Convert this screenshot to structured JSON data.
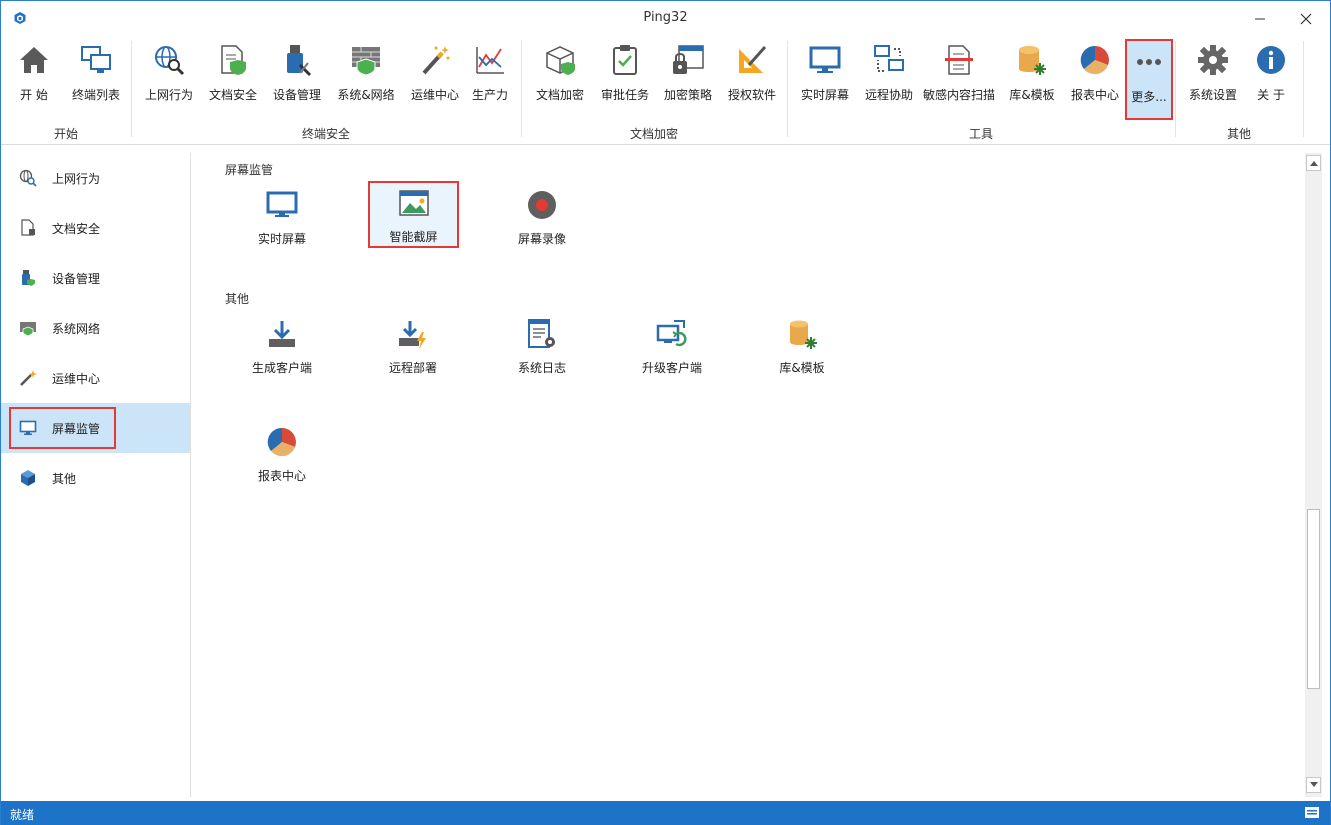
{
  "window": {
    "title": "Ping32"
  },
  "ribbon": {
    "groups": [
      {
        "label": "开始"
      },
      {
        "label": "终端安全"
      },
      {
        "label": "文档加密"
      },
      {
        "label": "工具"
      },
      {
        "label": "其他"
      }
    ],
    "buttons": [
      {
        "label": "开  始",
        "icon": "home-icon"
      },
      {
        "label": "终端列表",
        "icon": "terminal-list-icon"
      },
      {
        "label": "上网行为",
        "icon": "web-behavior-icon"
      },
      {
        "label": "文档安全",
        "icon": "document-security-icon"
      },
      {
        "label": "设备管理",
        "icon": "device-management-icon"
      },
      {
        "label": "系统&网络",
        "icon": "firewall-icon"
      },
      {
        "label": "运维中心",
        "icon": "magic-wand-icon"
      },
      {
        "label": "生产力",
        "icon": "productivity-chart-icon"
      },
      {
        "label": "文档加密",
        "icon": "encryption-box-icon"
      },
      {
        "label": "审批任务",
        "icon": "approval-clipboard-icon"
      },
      {
        "label": "加密策略",
        "icon": "encryption-policy-icon"
      },
      {
        "label": "授权软件",
        "icon": "authorized-software-icon"
      },
      {
        "label": "实时屏幕",
        "icon": "monitor-icon"
      },
      {
        "label": "远程协助",
        "icon": "remote-assist-icon"
      },
      {
        "label": "敏感内容扫描",
        "icon": "sensitive-scan-icon"
      },
      {
        "label": "库&模板",
        "icon": "database-template-icon"
      },
      {
        "label": "报表中心",
        "icon": "pie-chart-icon"
      },
      {
        "label": "更多...",
        "icon": "more-icon"
      },
      {
        "label": "系统设置",
        "icon": "gear-icon"
      },
      {
        "label": "关  于",
        "icon": "info-icon"
      }
    ]
  },
  "sidebar": {
    "items": [
      {
        "label": "上网行为",
        "icon": "web-behavior-icon"
      },
      {
        "label": "文档安全",
        "icon": "document-security-icon"
      },
      {
        "label": "设备管理",
        "icon": "device-management-icon"
      },
      {
        "label": "系统网络",
        "icon": "firewall-icon"
      },
      {
        "label": "运维中心",
        "icon": "magic-wand-icon"
      },
      {
        "label": "屏幕监管",
        "icon": "monitor-icon"
      },
      {
        "label": "其他",
        "icon": "cube-icon"
      }
    ],
    "active_index": 5
  },
  "main": {
    "sections": [
      {
        "title": "屏幕监管",
        "tiles": [
          {
            "label": "实时屏幕",
            "icon": "monitor-icon"
          },
          {
            "label": "智能截屏",
            "icon": "smart-screenshot-icon"
          },
          {
            "label": "屏幕录像",
            "icon": "record-icon"
          }
        ]
      },
      {
        "title": "其他",
        "tiles": [
          {
            "label": "生成客户端",
            "icon": "download-client-icon"
          },
          {
            "label": "远程部署",
            "icon": "remote-deploy-icon"
          },
          {
            "label": "系统日志",
            "icon": "system-log-icon"
          },
          {
            "label": "升级客户端",
            "icon": "upgrade-client-icon"
          },
          {
            "label": "库&模板",
            "icon": "database-template-icon"
          },
          {
            "label": "报表中心",
            "icon": "pie-chart-icon"
          }
        ]
      }
    ]
  },
  "statusbar": {
    "text": "就绪"
  },
  "colors": {
    "accent": "#1c73c8",
    "selection": "#cce4f7",
    "highlight_border": "#e53935",
    "icon_blue": "#2b6cb0"
  }
}
